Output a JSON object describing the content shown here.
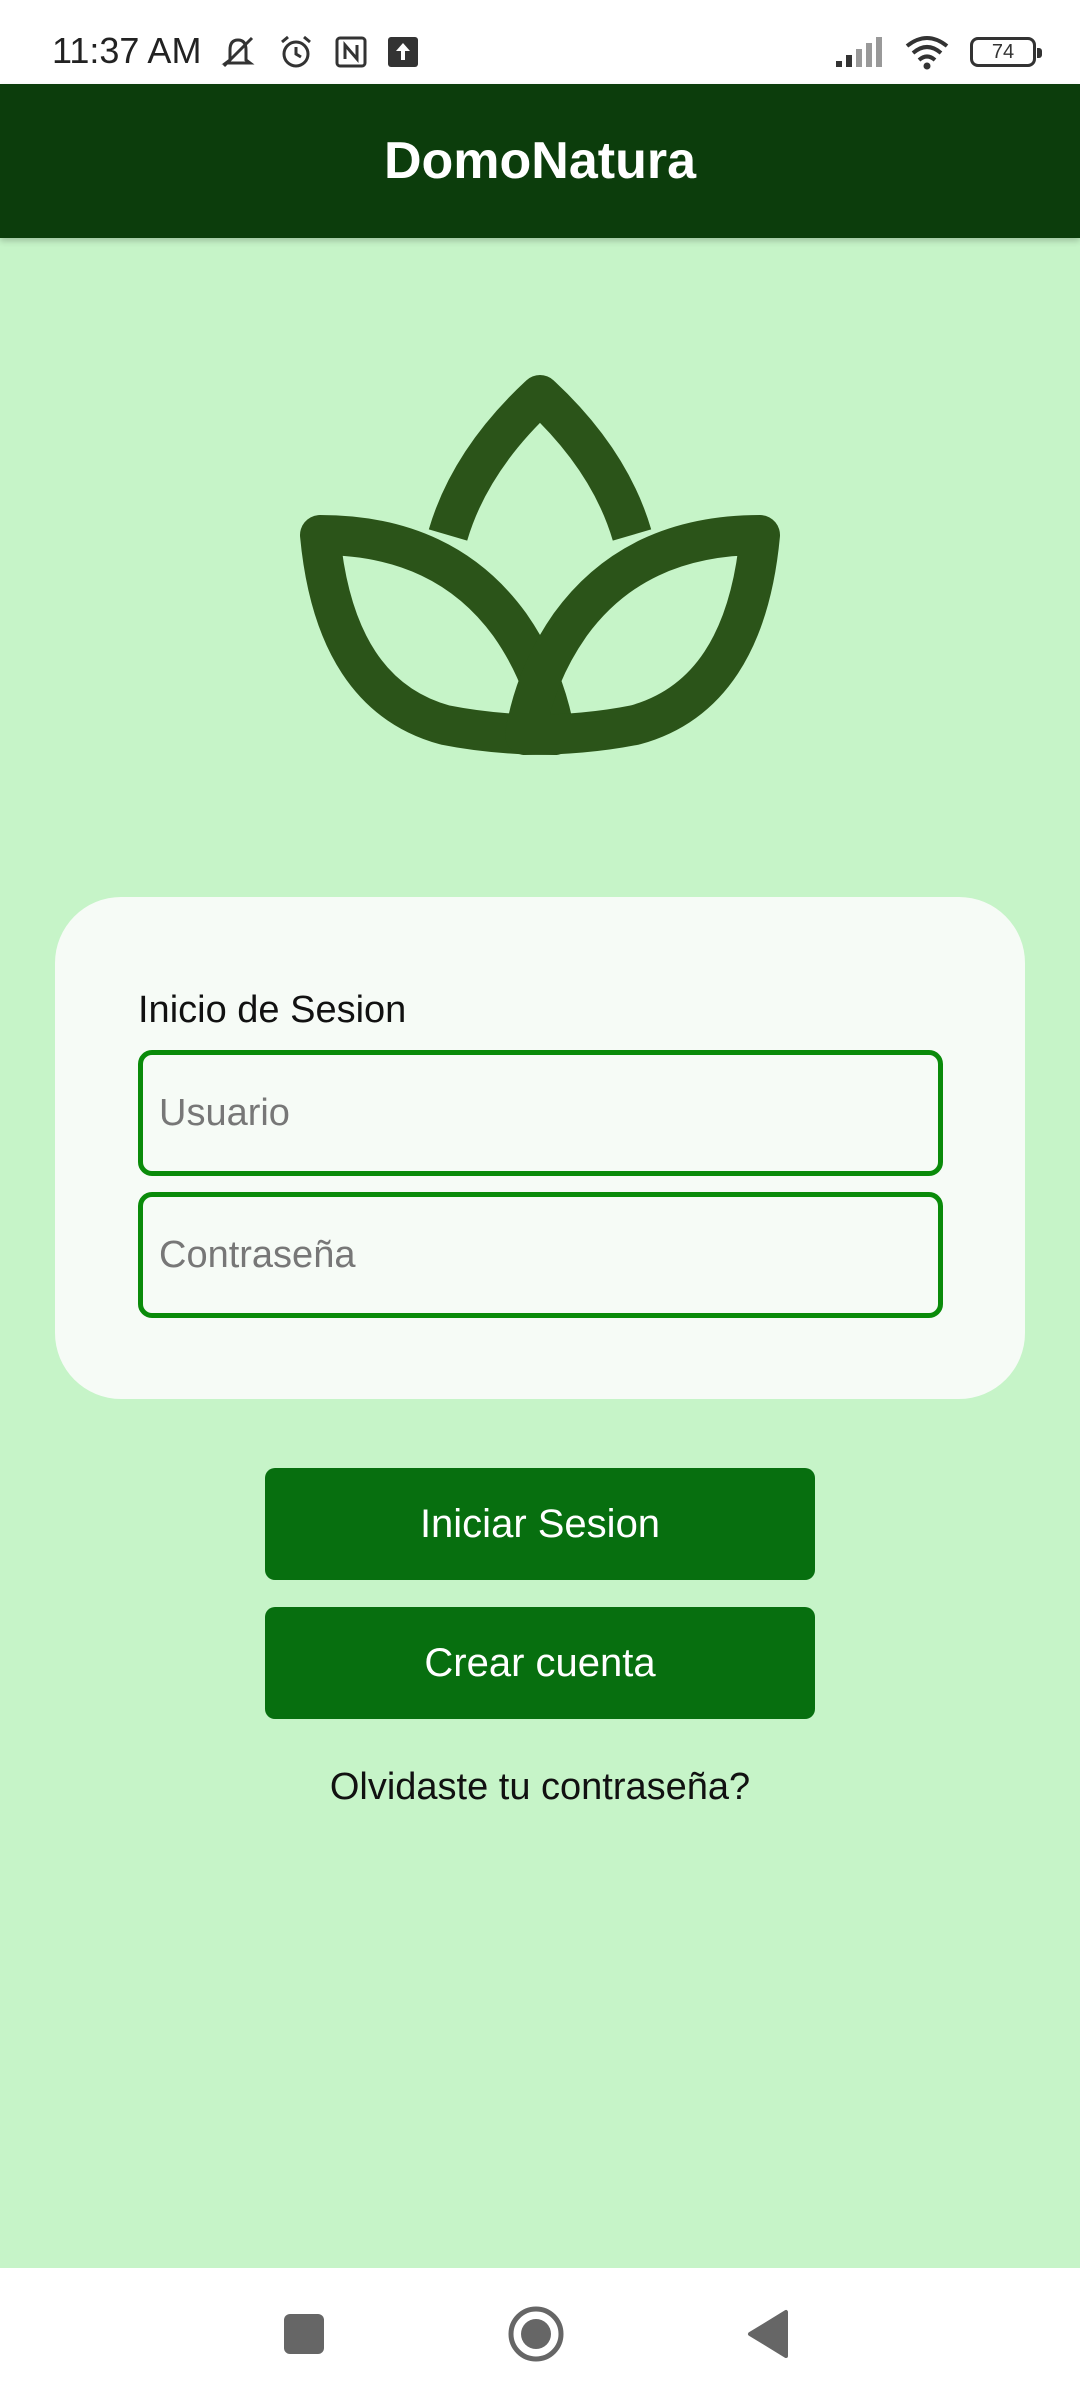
{
  "status_bar": {
    "time": "11:37 AM",
    "battery": "74",
    "icons": [
      "notifications-muted-icon",
      "alarm-icon",
      "nfc-icon",
      "upload-icon",
      "signal-icon",
      "wifi-icon",
      "battery-icon"
    ]
  },
  "app_bar": {
    "title": "DomoNatura"
  },
  "logo": {
    "icon": "leaf-lotus-icon",
    "color": "#2b5419"
  },
  "login_card": {
    "label": "Inicio de Sesion",
    "username_placeholder": "Usuario",
    "password_placeholder": "Contraseña"
  },
  "actions": {
    "login_label": "Iniciar Sesion",
    "create_label": "Crear cuenta",
    "forgot_label": "Olvidaste tu contraseña?"
  },
  "nav_bar": {
    "icons": [
      "recents-square-icon",
      "home-circle-icon",
      "back-triangle-icon"
    ]
  },
  "colors": {
    "background": "#c6f4c8",
    "app_bar": "#0c3d0c",
    "button": "#076f0f",
    "field_border": "#0a8b0a"
  }
}
